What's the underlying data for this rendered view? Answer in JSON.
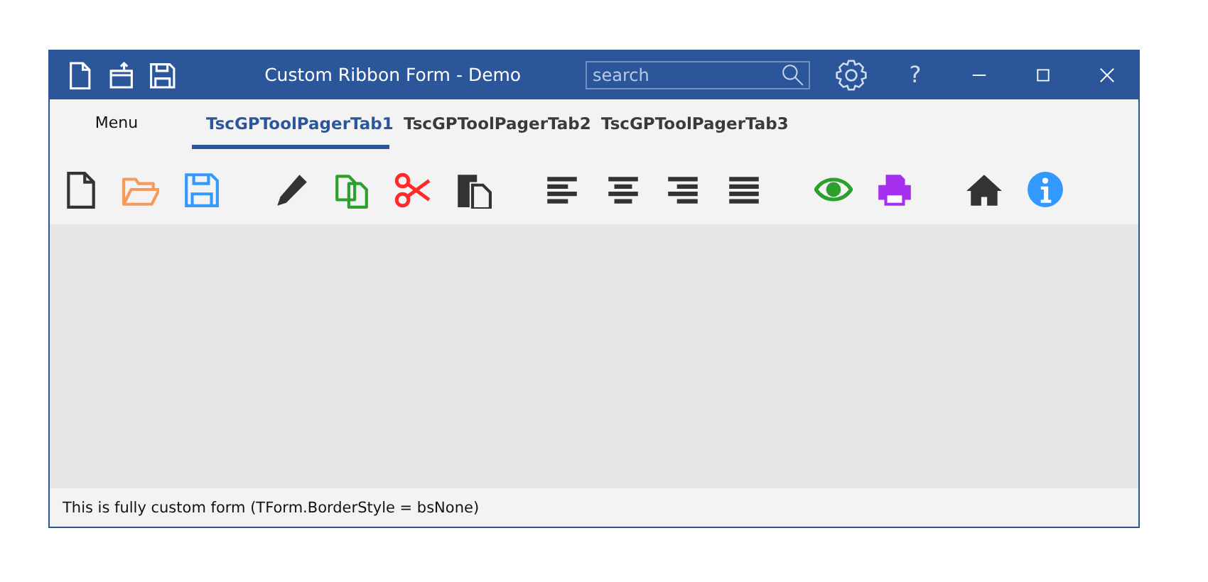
{
  "window": {
    "title": "Custom Ribbon Form - Demo"
  },
  "quick_access": [
    {
      "kind": "new"
    },
    {
      "kind": "upload"
    },
    {
      "kind": "save"
    }
  ],
  "search": {
    "placeholder": "search"
  },
  "title_buttons": [
    {
      "kind": "settings"
    },
    {
      "kind": "help",
      "label": "?"
    },
    {
      "kind": "minimize"
    },
    {
      "kind": "maximize"
    },
    {
      "kind": "close"
    }
  ],
  "menu": {
    "label": "Menu"
  },
  "tabs": [
    {
      "label": "TscGPToolPagerTab1",
      "selected": true
    },
    {
      "label": "TscGPToolPagerTab2",
      "selected": false
    },
    {
      "label": "TscGPToolPagerTab3",
      "selected": false
    }
  ],
  "toolbar": {
    "groups": [
      [
        {
          "kind": "new"
        },
        {
          "kind": "open"
        },
        {
          "kind": "save"
        }
      ],
      [
        {
          "kind": "edit"
        },
        {
          "kind": "copy"
        },
        {
          "kind": "cut"
        },
        {
          "kind": "paste"
        }
      ],
      [
        {
          "kind": "align-left"
        },
        {
          "kind": "align-center"
        },
        {
          "kind": "align-right"
        },
        {
          "kind": "justify"
        }
      ],
      [
        {
          "kind": "view"
        },
        {
          "kind": "print"
        }
      ],
      [
        {
          "kind": "home"
        },
        {
          "kind": "info"
        }
      ]
    ]
  },
  "status_bar": {
    "text": "This is fully custom form (TForm.BorderStyle = bsNone)"
  }
}
